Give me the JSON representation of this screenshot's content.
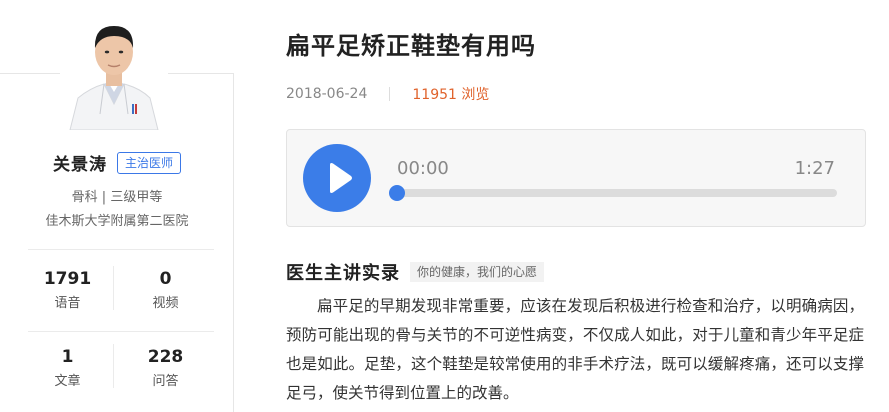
{
  "doctor": {
    "name": "关景涛",
    "title_badge": "主治医师",
    "department": "骨科 | 三级甲等",
    "hospital": "佳木斯大学附属第二医院",
    "stats": [
      {
        "value": "1791",
        "label": "语音"
      },
      {
        "value": "0",
        "label": "视频"
      },
      {
        "value": "1",
        "label": "文章"
      },
      {
        "value": "228",
        "label": "问答"
      }
    ]
  },
  "article": {
    "title": "扁平足矫正鞋垫有用吗",
    "date": "2018-06-24",
    "views": "11951 浏览"
  },
  "audio": {
    "current_time": "00:00",
    "total_time": "1:27",
    "progress_fraction": 0
  },
  "section": {
    "title": "医生主讲实录",
    "tag": "你的健康，我们的心愿",
    "body": "扁平足的早期发现非常重要，应该在发现后积极进行检查和治疗，以明确病因，预防可能出现的骨与关节的不可逆性病变，不仅成人如此，对于儿童和青少年平足症也是如此。足垫，这个鞋垫是较常使用的非手术疗法，既可以缓解疼痛，还可以支撑足弓，使关节得到位置上的改善。"
  },
  "colors": {
    "accent": "#3b7de8",
    "views": "#e0632c"
  },
  "icons": {
    "play": "play-icon"
  }
}
